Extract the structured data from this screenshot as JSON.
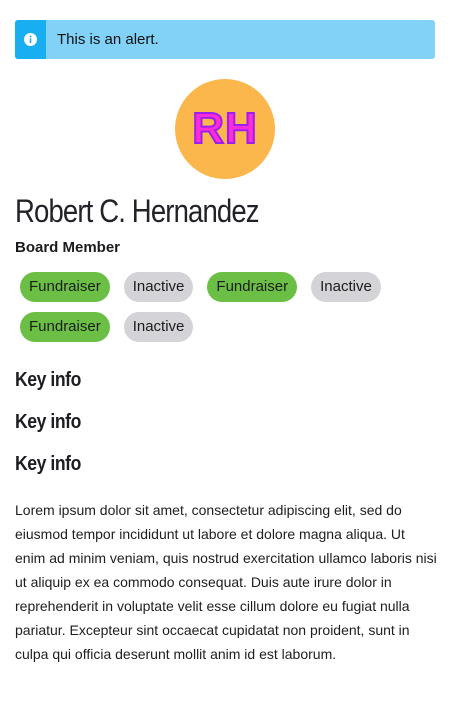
{
  "alert": {
    "icon": "info-icon",
    "text": "This is an alert.",
    "colors": {
      "background": "#82d1f7",
      "icon_background": "#18aef0"
    }
  },
  "profile": {
    "initials": "RH",
    "avatar_color": "#fbb74c",
    "name": "Robert C. Hernandez",
    "role": "Board Member"
  },
  "tags": [
    [
      {
        "label": "Fundraiser",
        "color": "#6cbf45"
      },
      {
        "label": "Inactive",
        "color": "#d4d4d8"
      },
      {
        "label": "Fundraiser",
        "color": "#6cbf45"
      },
      {
        "label": "Inactive",
        "color": "#d4d4d8"
      }
    ],
    [
      {
        "label": "Fundraiser",
        "color": "#6cbf45"
      },
      {
        "label": "Inactive",
        "color": "#d4d4d8"
      }
    ]
  ],
  "sections": [
    "Key info",
    "Key info",
    "Key info"
  ],
  "body": "Lorem ipsum dolor sit amet, consectetur adipiscing elit, sed do eiusmod tempor incididunt ut labore et dolore magna aliqua. Ut enim ad minim veniam, quis nostrud exercitation ullamco laboris nisi ut aliquip ex ea commodo consequat. Duis aute irure dolor in reprehenderit in voluptate velit esse cillum dolore eu fugiat nulla pariatur. Excepteur sint occaecat cupidatat non proident, sunt in culpa qui officia deserunt mollit anim id est laborum."
}
